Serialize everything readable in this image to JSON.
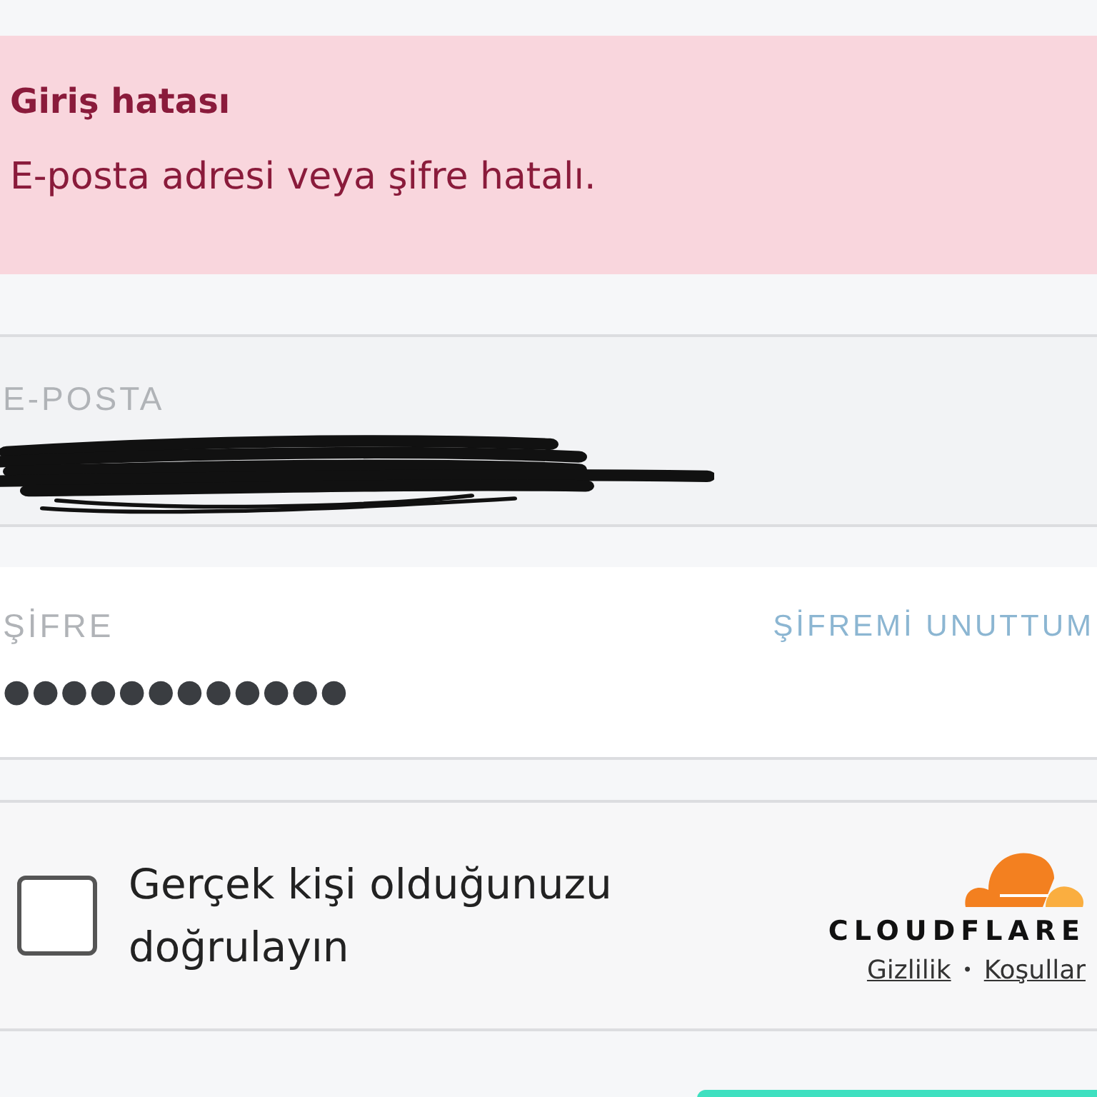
{
  "error": {
    "title": "Giriş hatası",
    "message": "E-posta adresi veya şifre hatalı."
  },
  "email": {
    "label": "E-POSTA",
    "redacted": true
  },
  "password": {
    "label": "ŞİFRE",
    "value": "●●●●●●●●●●●●",
    "link": "ŞİFREMİ UNUTTUM"
  },
  "captcha": {
    "label": "Gerçek kişi olduğunuzu doğrulayın",
    "checked": false,
    "brand": "CLOUDFLARE",
    "links": [
      "Gizlilik",
      "Koşullar"
    ],
    "separator": "•"
  }
}
